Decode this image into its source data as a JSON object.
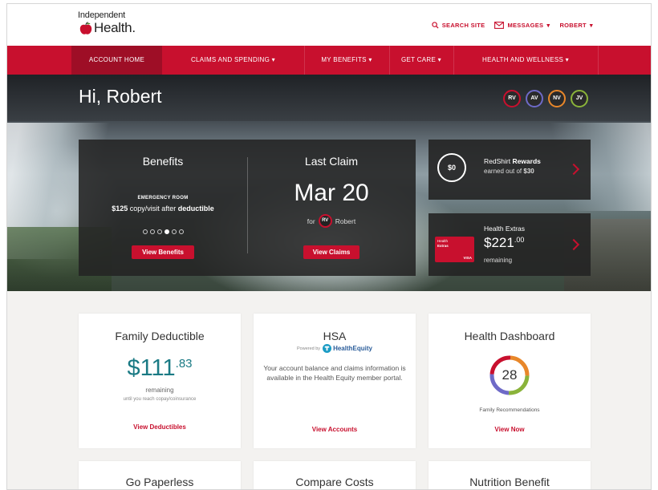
{
  "brand": {
    "line1": "Independent",
    "line2": "Health.",
    "accent": "#c8102e",
    "teal": "#1a7a84"
  },
  "top_links": {
    "search": "SEARCH SITE",
    "messages": "MESSAGES",
    "user": "ROBERT"
  },
  "nav": [
    {
      "label": "ACCOUNT HOME",
      "active": true
    },
    {
      "label": "CLAIMS AND SPENDING ▾"
    },
    {
      "label": "MY BENEFITS ▾"
    },
    {
      "label": "GET CARE ▾"
    },
    {
      "label": "HEALTH AND WELLNESS ▾"
    }
  ],
  "hero": {
    "greeting": "Hi, Robert",
    "avatars": [
      {
        "initials": "RV",
        "color": "#c8102e"
      },
      {
        "initials": "AV",
        "color": "#6e6ac7"
      },
      {
        "initials": "NV",
        "color": "#e8872a"
      },
      {
        "initials": "JV",
        "color": "#8ab33a"
      }
    ],
    "benefits": {
      "title": "Benefits",
      "er_label": "EMERGENCY ROOM",
      "er_amount": "$125",
      "er_mid": " copy/visit after ",
      "er_bold": "deductible",
      "dots_total": 6,
      "dots_active": 4,
      "button": "View Benefits"
    },
    "last_claim": {
      "title": "Last Claim",
      "date": "Mar 20",
      "for": "for",
      "initials": "RV",
      "name": "Robert",
      "button": "View Claims"
    },
    "rewards": {
      "amount": "$0",
      "title_plain": "RedShirt ",
      "title_bold": "Rewards",
      "sub_plain": "earned out of ",
      "sub_bold": "$30"
    },
    "extras": {
      "title": "Health Extras",
      "amount": "$221",
      "cents": ".00",
      "sub": "remaining",
      "card_line1": "Health",
      "card_line2": "Extras",
      "card_brand": "VISA"
    }
  },
  "tiles": {
    "deductible": {
      "title": "Family Deductible",
      "amount": "$111",
      "cents": ".83",
      "remaining": "remaining",
      "note": "until you reach copay/coinsurance",
      "link": "View Deductibles"
    },
    "hsa": {
      "title": "HSA",
      "powered": "Powered by",
      "partner": "HealthEquity",
      "text": "Your account balance and claims information is available in the Health Equity member portal.",
      "link": "View Accounts"
    },
    "dashboard": {
      "title": "Health Dashboard",
      "count": "28",
      "caption": "Family Recommendations",
      "link": "View Now"
    },
    "row2": [
      "Go Paperless",
      "Compare Costs",
      "Nutrition Benefit"
    ]
  }
}
